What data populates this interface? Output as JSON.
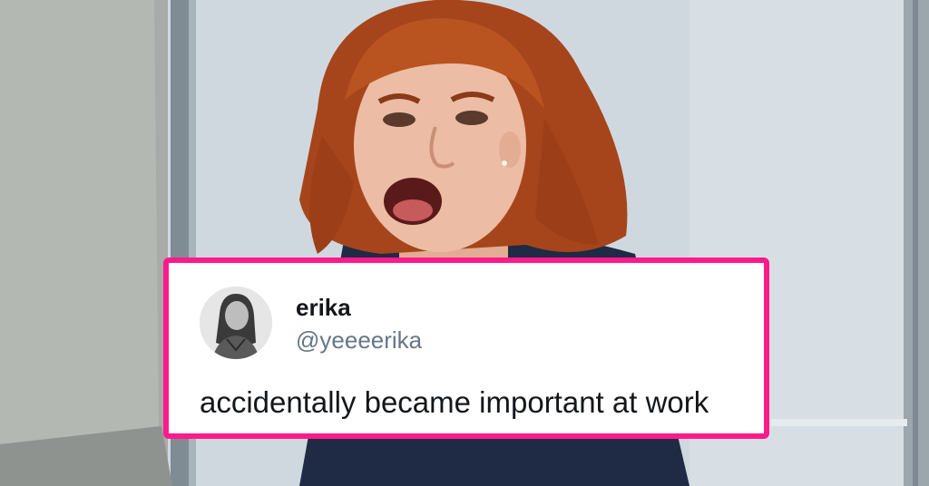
{
  "photo": {
    "description_icon": "screaming-woman-photo",
    "colors": {
      "wall": "#cfd8df",
      "hair": "#b2501f",
      "skin": "#e9b9a0",
      "shirt": "#1f2a44",
      "sofa": "#a9aea9"
    }
  },
  "tweet": {
    "border_color": "#ff1a8c",
    "avatar_icon": "profile-avatar",
    "display_name": "erika",
    "handle": "@yeeeerika",
    "text": "accidentally became important at work"
  }
}
